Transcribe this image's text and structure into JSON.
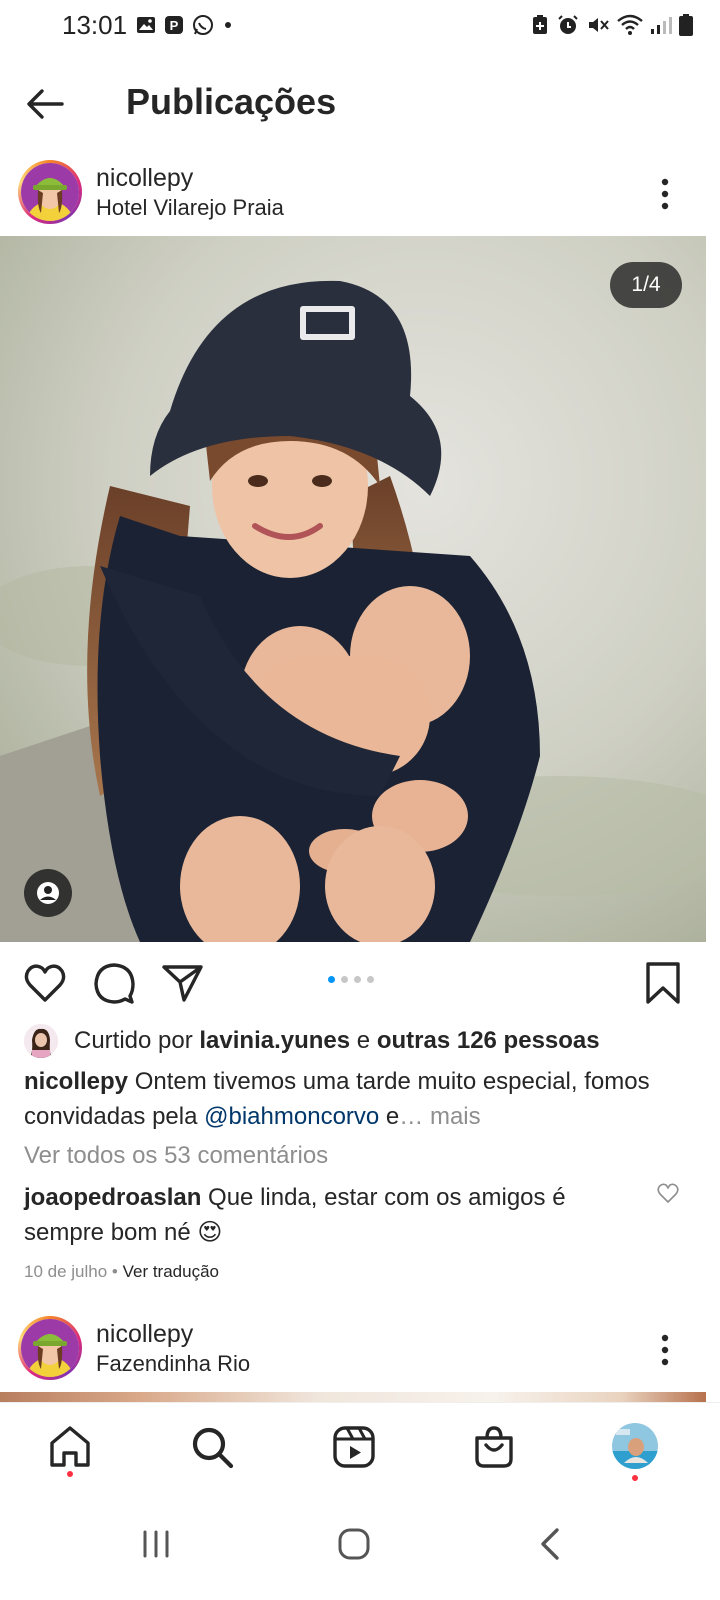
{
  "status_bar": {
    "time": "13:01",
    "left_icons": [
      "gallery-icon",
      "parking-app-icon",
      "whatsapp-icon",
      "dot-icon"
    ],
    "right_icons": [
      "battery-saver-icon",
      "alarm-icon",
      "mute-icon",
      "wifi-icon",
      "signal-icon",
      "battery-icon"
    ]
  },
  "header": {
    "title": "Publicações",
    "back_icon": "arrow-left-icon"
  },
  "posts": [
    {
      "username": "nicollepy",
      "location": "Hotel Vilarejo Praia",
      "carousel_counter": "1/4",
      "carousel_index": 1,
      "carousel_total": 4,
      "liked_by_prefix": "Curtido por ",
      "liked_by_user": "lavinia.yunes",
      "liked_by_join": " e ",
      "liked_by_others": "outras 126 pessoas",
      "caption_user": "nicollepy",
      "caption_text": " Ontem tivemos uma tarde muito especial, fomos convidadas pela ",
      "caption_mention": "@biahmoncorvo",
      "caption_tail": " e",
      "caption_more": "… mais",
      "view_comments": "Ver todos os 53 comentários",
      "comment_user": "joaopedroaslan",
      "comment_text": " Que linda, estar com os amigos é sempre bom né ",
      "comment_emoji": "😍",
      "date": "10 de julho",
      "separator": " • ",
      "translate": "Ver tradução"
    },
    {
      "username": "nicollepy",
      "location": "Fazendinha Rio"
    }
  ],
  "actions": [
    "heart-icon",
    "comment-icon",
    "share-icon",
    "bookmark-icon"
  ],
  "bottom_nav": [
    "home-icon",
    "search-icon",
    "reels-icon",
    "shop-icon",
    "profile-avatar"
  ],
  "system_nav": [
    "recents-icon",
    "home-circle-icon",
    "back-chevron-icon"
  ],
  "colors": {
    "accent": "#0095f6",
    "mention": "#00376b",
    "muted": "#8e8e8e",
    "notification": "#ff3040"
  }
}
